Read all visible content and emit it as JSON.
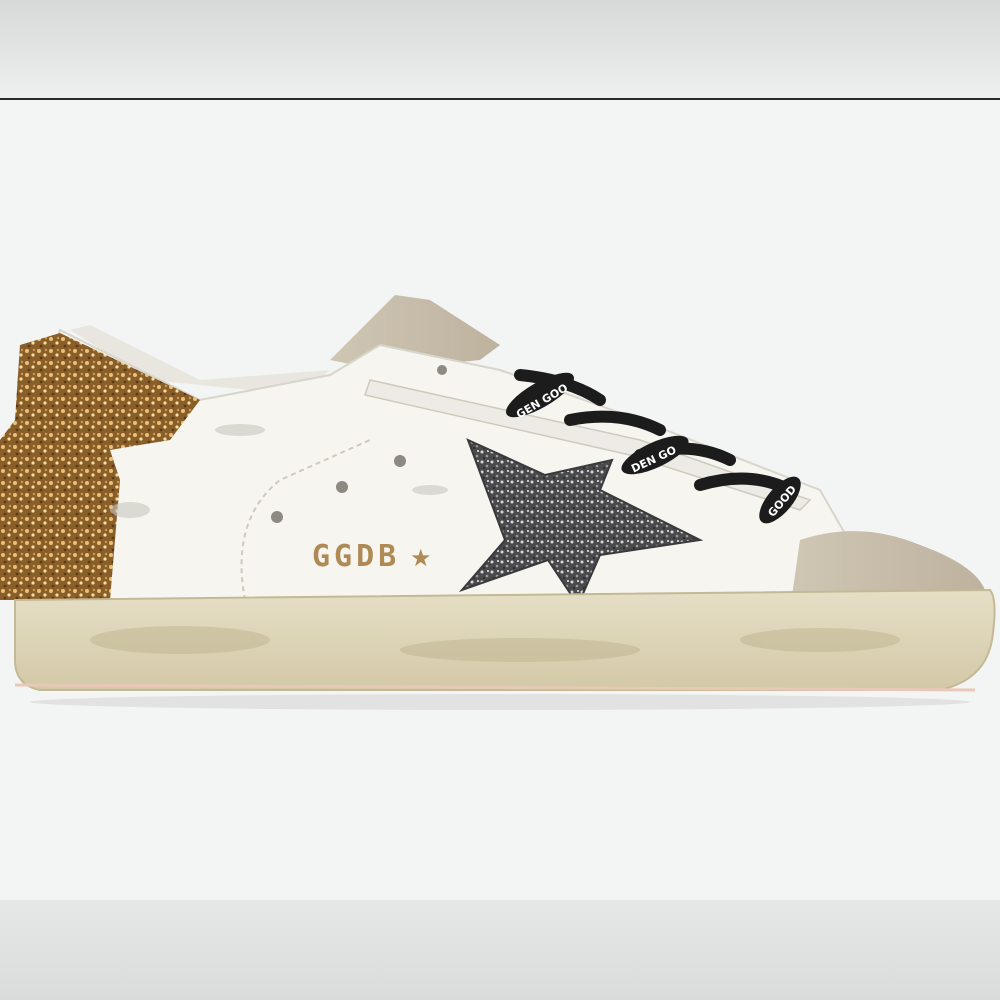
{
  "photo": {
    "subject": "sneaker-photo",
    "colors": {
      "background": "#f3f4f4",
      "upper_leather": "#f6f5f0",
      "suede": "#c9bfad",
      "heel_glitter": "#a87a3a",
      "star_glitter": "#5a5a5c",
      "sole": "#ded6bc",
      "laces": "#1c1c1c",
      "logo_gold": "#b08a55"
    }
  },
  "sneaker": {
    "logo_text": "GGDB",
    "logo_star": "★",
    "lace_print_1": "GEN GOO",
    "lace_print_2": "DEN GO",
    "lace_print_3": "GOOD"
  }
}
